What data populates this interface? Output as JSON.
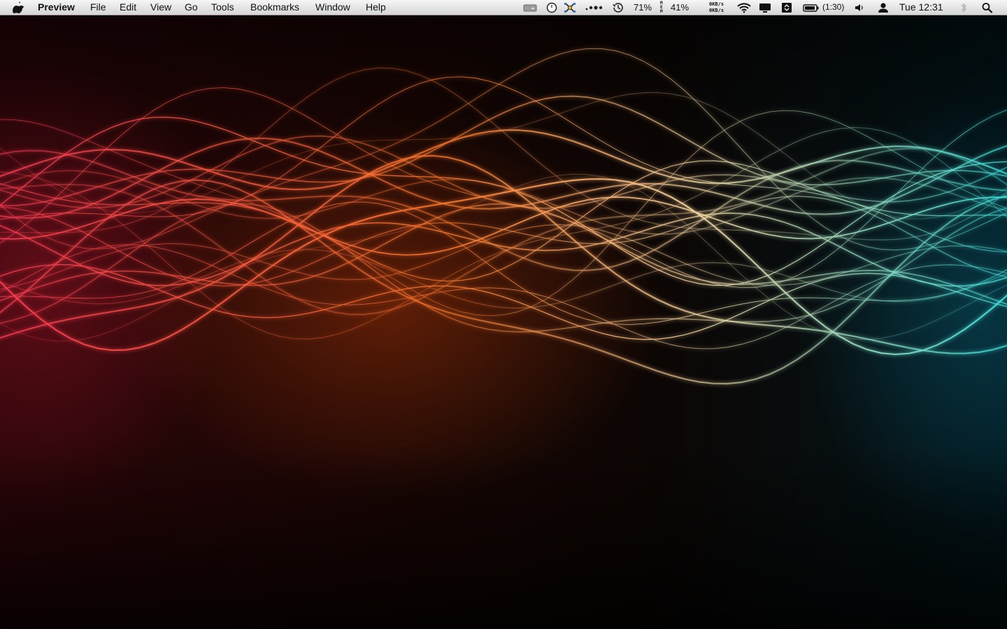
{
  "menubar": {
    "app_name": "Preview",
    "menus": [
      "File",
      "Edit",
      "View",
      "Go",
      "Tools",
      "Bookmarks",
      "Window",
      "Help"
    ],
    "status": {
      "cpu": "71%",
      "mem_label": "M\nE\nM",
      "mem": "41%",
      "net_up": "0KB/s",
      "net_down": "0KB/s",
      "battery_time": "(1:30)",
      "clock": "Tue 12:31"
    }
  },
  "icons": [
    "apple-icon",
    "drive-icon",
    "clock-icon",
    "network-x-icon",
    "dots-icon",
    "time-machine-icon",
    "wifi-icon",
    "display-icon",
    "sync-icon",
    "battery-icon",
    "volume-icon",
    "user-icon",
    "bluetooth-icon",
    "spotlight-icon"
  ],
  "wallpaper": {
    "colors": {
      "left": "#ff3a55",
      "middle": "#ff7a2a",
      "right": "#3fe6e0"
    }
  }
}
